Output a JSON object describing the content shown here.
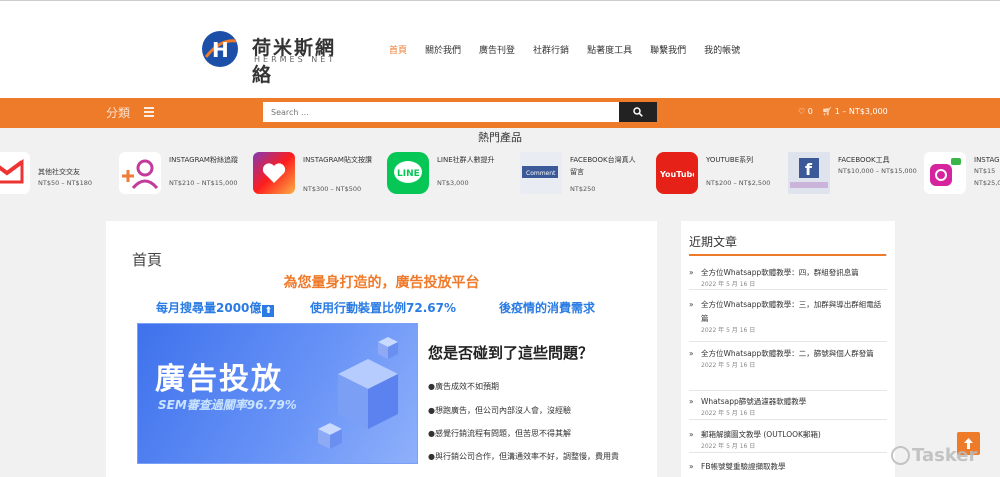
{
  "brand": {
    "name_cn": "荷米斯網絡",
    "name_en": "HERMES NET",
    "colors": {
      "accent": "#ee7b2a",
      "link": "#2a7be4",
      "dark": "#222222"
    }
  },
  "nav": {
    "items": [
      {
        "label": "首頁",
        "active": true
      },
      {
        "label": "關於我們"
      },
      {
        "label": "廣告刊登"
      },
      {
        "label": "社群行銷"
      },
      {
        "label": "點著度工具"
      },
      {
        "label": "聯繫我們"
      },
      {
        "label": "我的帳號"
      }
    ]
  },
  "toolbar": {
    "category_label": "分類",
    "search_placeholder": "Search ...",
    "wishlist_count": "0",
    "cart_text": "1 – NT$3,000"
  },
  "products": {
    "title": "熱門產品",
    "items": [
      {
        "name": "其他社交交友",
        "price": "NT$50 – NT$180",
        "icon": "gmail-icon"
      },
      {
        "name": "INSTAGRAM粉絲追蹤",
        "price": "NT$210 – NT$15,000",
        "icon": "add-user-icon"
      },
      {
        "name": "INSTAGRAM貼文按讚",
        "price": "NT$300 – NT$500",
        "icon": "heart-icon"
      },
      {
        "name": "LINE社群人數提升",
        "price": "NT$3,000",
        "icon": "line-icon"
      },
      {
        "name": "FACEBOOK台灣真人留言",
        "price": "NT$250",
        "icon": "comment-icon"
      },
      {
        "name": "YOUTUBE系列",
        "price": "NT$200 – NT$2,500",
        "icon": "youtube-icon"
      },
      {
        "name": "FACEBOOK工具",
        "price": "NT$10,000 – NT$15,000",
        "icon": "facebook-icon"
      },
      {
        "name": "INSTAG",
        "price": "NT$15",
        "price2": "NT$25,0",
        "icon": "instagram-icon"
      }
    ]
  },
  "main": {
    "page_title": "首頁",
    "headline": "為您量身打造的，廣告投放平台",
    "stats": [
      "每月搜尋量2000億",
      "使用行動裝置比例72.67%",
      "後疫情的消費需求"
    ],
    "banner_title": "廣告投放",
    "banner_subtitle": "SEM審查過關率96.79%",
    "question_title": "您是否碰到了這些問題？",
    "bullets": [
      "●廣告成效不如預期",
      "●想跑廣告，但公司內部沒人會，沒經驗",
      "●感覺行銷流程有問題，但苦思不得其解",
      "●與行銷公司合作，但溝通效率不好，調整慢，費用貴"
    ]
  },
  "sidebar": {
    "title": "近期文章",
    "posts": [
      {
        "title": "全方位Whatsapp軟體教學：四，群組發訊息篇",
        "date": "2022 年 5 月 16 日"
      },
      {
        "title": "全方位Whatsapp軟體教學：三，加群與導出群組電話篇",
        "date": "2022 年 5 月 16 日"
      },
      {
        "title": "全方位Whatsapp軟體教學：二，篩號與個人群發篇",
        "date": "2022 年 5 月 16 日"
      },
      {
        "title": "Whatsapp篩號過濾器軟體教學",
        "date": "2022 年 5 月 16 日"
      },
      {
        "title": "郵箱解擴圖文教學 (OUTLOOK郵箱)",
        "date": "2022 年 5 月 16 日"
      },
      {
        "title": "FB帳號雙重驗證擷取教學",
        "date": ""
      }
    ]
  },
  "watermark": "Tasker"
}
